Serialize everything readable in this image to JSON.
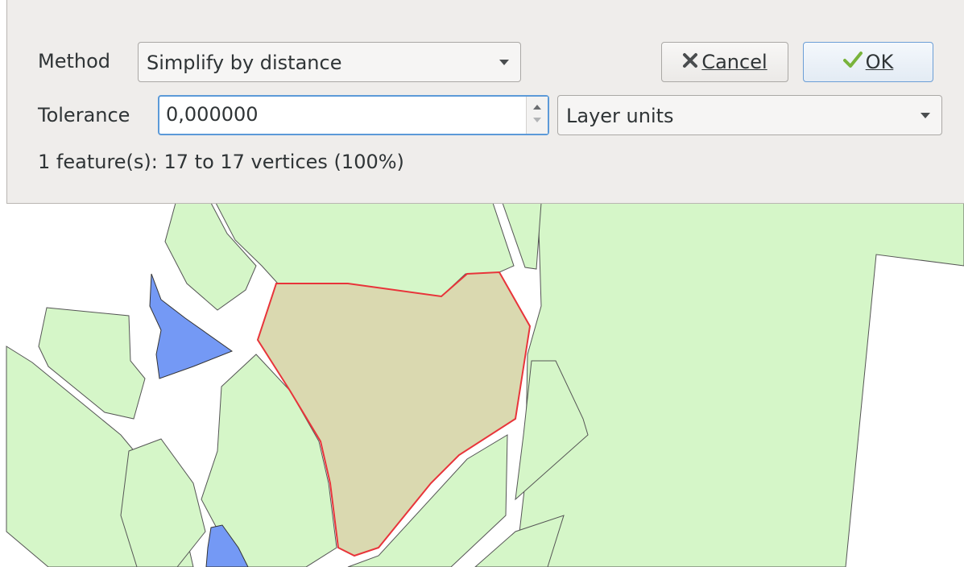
{
  "dialog": {
    "method_label": "Method",
    "method_value": "Simplify by distance",
    "cancel_label": "Cancel",
    "cancel_icon": "cross-icon",
    "ok_label": "OK",
    "ok_icon": "checkmark-icon",
    "tolerance_label": "Tolerance",
    "tolerance_value": "0,000000",
    "units_value": "Layer units",
    "status_text": "1 feature(s): 17 to 17 vertices (100%)"
  },
  "colors": {
    "dialog_bg": "#efedeb",
    "map_bg": "#ffffff",
    "land_fill": "#d5f6c8",
    "water_fill": "#7499f5",
    "selected_fill": "#dad9b0",
    "selected_outline": "#e8343a",
    "focus_border": "#5c9ad8"
  }
}
